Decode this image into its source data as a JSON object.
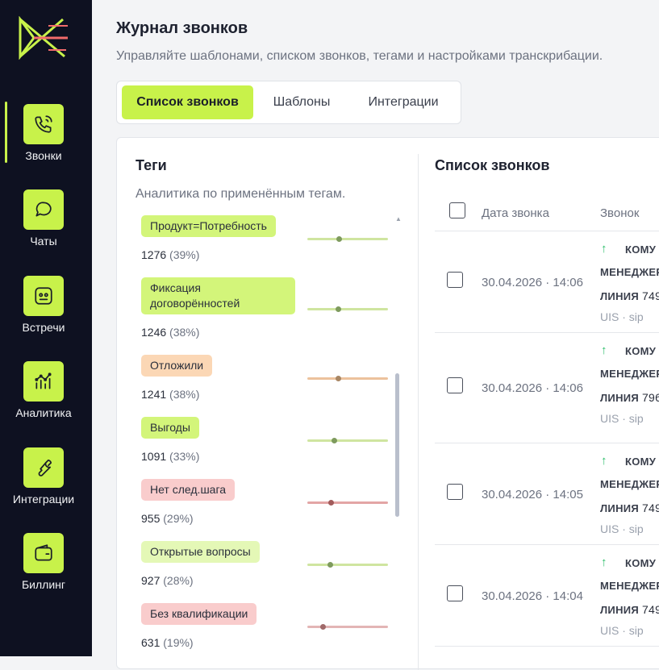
{
  "colors": {
    "accent": "#c8f24a",
    "sidebar_bg": "#0e1121",
    "green_tag": "#d3f57a",
    "orange_tag": "#fbd7b5",
    "red_tag": "#f9cccc",
    "call_arrow": "#2fbf6b"
  },
  "sidebar": {
    "items": [
      {
        "label": "Звонки",
        "icon": "phone-icon"
      },
      {
        "label": "Чаты",
        "icon": "chat-bubble-icon"
      },
      {
        "label": "Встречи",
        "icon": "face-icon"
      },
      {
        "label": "Аналитика",
        "icon": "analytics-icon"
      },
      {
        "label": "Интеграции",
        "icon": "wrench-icon"
      },
      {
        "label": "Биллинг",
        "icon": "wallet-icon"
      }
    ]
  },
  "header": {
    "title": "Журнал звонков",
    "subtitle": "Управляйте шаблонами, списком звонков, тегами и настройками транскрибации."
  },
  "tabs": [
    {
      "label": "Список звонков",
      "active": true
    },
    {
      "label": "Шаблоны",
      "active": false
    },
    {
      "label": "Интеграции",
      "active": false
    }
  ],
  "tags_panel": {
    "title": "Теги",
    "subtitle": "Аналитика по применённым тегам.",
    "tags": [
      {
        "label": "Продукт=Потребность",
        "count": "1276",
        "pct": "(39%)",
        "tone": "green",
        "share": 0.39
      },
      {
        "label": "Фиксация договорённостей",
        "count": "1246",
        "pct": "(38%)",
        "tone": "green",
        "share": 0.38
      },
      {
        "label": "Отложили",
        "count": "1241",
        "pct": "(38%)",
        "tone": "orange",
        "share": 0.38
      },
      {
        "label": "Выгоды",
        "count": "1091",
        "pct": "(33%)",
        "tone": "green",
        "share": 0.33
      },
      {
        "label": "Нет след.шага",
        "count": "955",
        "pct": "(29%)",
        "tone": "red",
        "share": 0.29
      },
      {
        "label": "Открытые вопросы",
        "count": "927",
        "pct": "(28%)",
        "tone": "green",
        "share": 0.28
      },
      {
        "label": "Без квалификации",
        "count": "631",
        "pct": "(19%)",
        "tone": "red",
        "share": 0.19
      }
    ]
  },
  "calls_panel": {
    "title": "Список звонков",
    "columns": {
      "date": "Дата звонка",
      "call": "Звонок"
    },
    "rows": [
      {
        "date": "30.04.2026 · 14:06",
        "direction": "КОМУ",
        "manager": "МЕНЕДЖЕР",
        "line_label": "ЛИНИЯ",
        "line_number": "749",
        "source": "UIS · sip"
      },
      {
        "date": "30.04.2026 · 14:06",
        "direction": "КОМУ",
        "manager": "МЕНЕДЖЕР",
        "line_label": "ЛИНИЯ",
        "line_number": "796",
        "source": "UIS · sip"
      },
      {
        "date": "30.04.2026 · 14:05",
        "direction": "КОМУ",
        "manager": "МЕНЕДЖЕР",
        "line_label": "ЛИНИЯ",
        "line_number": "749",
        "source": "UIS · sip"
      },
      {
        "date": "30.04.2026 · 14:04",
        "direction": "КОМУ",
        "manager": "МЕНЕДЖЕР",
        "line_label": "ЛИНИЯ",
        "line_number": "749",
        "source": "UIS · sip"
      }
    ]
  }
}
